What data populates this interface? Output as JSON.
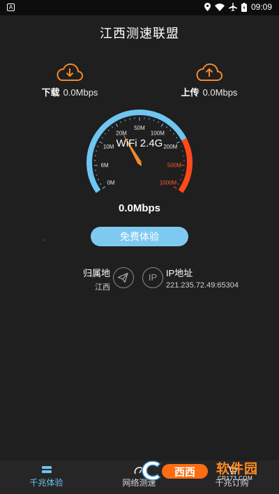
{
  "status_bar": {
    "left_badge": "A",
    "time": "09:09",
    "icons": [
      "location-icon",
      "wifi-icon",
      "airplane-icon",
      "battery-icon"
    ]
  },
  "app": {
    "title": "江西测速联盟"
  },
  "download": {
    "label": "下载",
    "value": "0.0Mbps",
    "icon": "cloud-download-icon"
  },
  "upload": {
    "label": "上传",
    "value": "0.0Mbps",
    "icon": "cloud-upload-icon"
  },
  "gauge": {
    "network_label": "WiFi 2.4G",
    "ticks": [
      "0M",
      "6M",
      "10M",
      "20M",
      "50M",
      "100M",
      "200M",
      "500M",
      "1000M"
    ],
    "needle_fraction": 0.38,
    "cold_color": "#6ec6f1",
    "hot_color": "#ff4a1c"
  },
  "speed": {
    "value": "0.0Mbps"
  },
  "trial_button": {
    "label": "免费体验"
  },
  "location": {
    "title": "归属地",
    "value": "江西"
  },
  "ip": {
    "badge": "IP",
    "title": "IP地址",
    "value": "221.235.72.49:65304"
  },
  "nav": {
    "items": [
      {
        "label": "千兆体验",
        "icon": "menu-icon",
        "active": true
      },
      {
        "label": "网络测速",
        "icon": "speedometer-icon",
        "active": false
      },
      {
        "label": "千兆订购",
        "icon": "cart-icon",
        "active": false
      }
    ]
  },
  "watermark": {
    "text": "软件园",
    "url": "CR173.COM",
    "logo_text": "西西"
  },
  "colors": {
    "accent": "#7ec9f0",
    "orange": "#f08a2c",
    "background": "#1f1f1f"
  }
}
